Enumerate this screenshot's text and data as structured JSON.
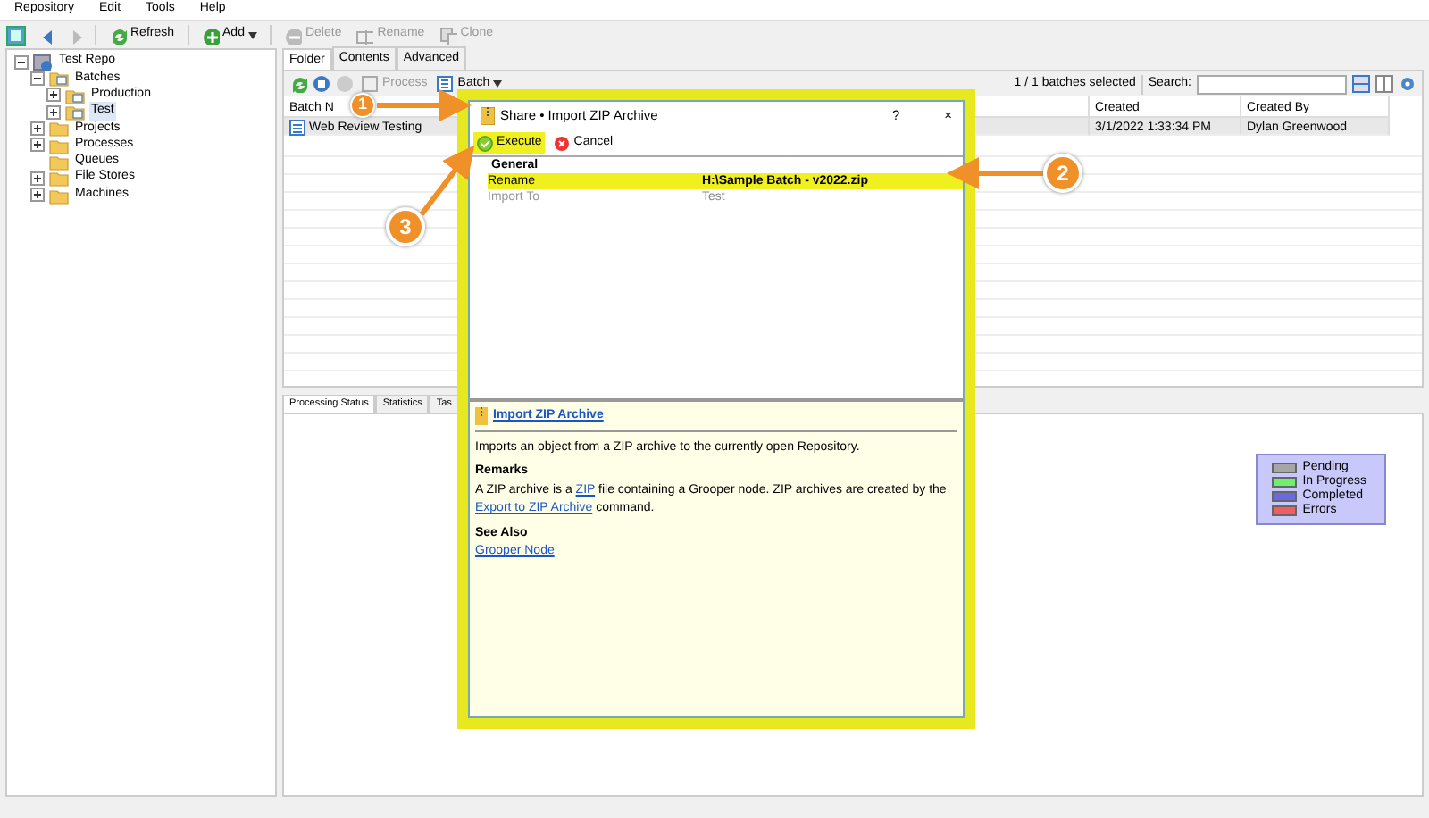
{
  "menu": [
    "Repository",
    "Edit",
    "Tools",
    "Help"
  ],
  "toolbar": [
    {
      "kind": "nav-back",
      "disabled": false
    },
    {
      "kind": "nav-forward",
      "disabled": true
    },
    {
      "kind": "refresh",
      "label": "Refresh",
      "disabled": false
    },
    {
      "kind": "add",
      "label": "Add",
      "disabled": false,
      "dropdown": true
    },
    {
      "kind": "delete",
      "label": "Delete",
      "disabled": true
    },
    {
      "kind": "rename",
      "label": "Rename",
      "disabled": true
    },
    {
      "kind": "clone",
      "label": "Clone",
      "disabled": true
    }
  ],
  "tree": [
    {
      "label": "Test Repo",
      "kind": "repo",
      "expanded": true,
      "selected": false,
      "children": [
        {
          "label": "Batches",
          "kind": "batches",
          "expanded": true,
          "selected": false,
          "children": [
            {
              "label": "Production",
              "kind": "batches",
              "expanded": false,
              "selected": false
            },
            {
              "label": "Test",
              "kind": "batches",
              "expanded": false,
              "selected": true
            }
          ]
        },
        {
          "label": "Projects",
          "kind": "folder",
          "expanded": false,
          "selected": false
        },
        {
          "label": "Processes",
          "kind": "folder",
          "expanded": false,
          "selected": false
        },
        {
          "label": "Queues",
          "kind": "leaf",
          "selected": false
        },
        {
          "label": "File Stores",
          "kind": "folder",
          "expanded": false,
          "selected": false
        },
        {
          "label": "Machines",
          "kind": "folder",
          "expanded": false,
          "selected": false
        }
      ]
    }
  ],
  "tabs": [
    {
      "label": "Folder",
      "selected": true
    },
    {
      "label": "Contents",
      "selected": false
    },
    {
      "label": "Advanced",
      "selected": false
    }
  ],
  "folder_toolbar": {
    "process": {
      "label": "Process",
      "disabled": true
    },
    "batch": {
      "label": "Batch"
    },
    "selection": "1 / 1 batches selected",
    "search_label": "Search:"
  },
  "table": {
    "columns": [
      "Batch N",
      "Created",
      "Created By"
    ],
    "rows": [
      {
        "cells": [
          "Web Review Testing",
          "3/1/2022 1:33:34 PM",
          "Dylan Greenwood"
        ],
        "selected": true
      }
    ]
  },
  "bottom_tabs": [
    {
      "label": "Processing Status",
      "selected": true
    },
    {
      "label": "Statistics",
      "selected": false
    },
    {
      "label": "Tas",
      "selected": false
    }
  ],
  "legend": [
    {
      "label": "Pending",
      "color": "#a6a6a6"
    },
    {
      "label": "In Progress",
      "color": "#6fef6f"
    },
    {
      "label": "Completed",
      "color": "#6a6ade"
    },
    {
      "label": "Errors",
      "color": "#ef5f5f"
    }
  ],
  "dialog": {
    "title": "Share • Import ZIP Archive",
    "help": "?",
    "close": "×",
    "buttons": [
      {
        "kind": "execute",
        "label": "Execute",
        "highlighted": true
      },
      {
        "kind": "cancel",
        "label": "Cancel",
        "highlighted": false
      }
    ],
    "section": "General",
    "properties": [
      {
        "name": "Rename",
        "value": "H:\\Sample Batch - v2022.zip",
        "highlighted": true
      },
      {
        "name": "Import To",
        "value": "Test",
        "highlighted": false
      }
    ],
    "help_panel": {
      "title": "Import ZIP Archive",
      "description": "Imports an object from a ZIP archive to the currently open Repository.",
      "remarks_heading": "Remarks",
      "remarks": [
        {
          "kind": "text",
          "text": "A ZIP archive is a "
        },
        {
          "kind": "link",
          "text": "ZIP"
        },
        {
          "kind": "text",
          "text": " file containing a Grooper node. ZIP archives are created by the "
        },
        {
          "kind": "link",
          "text": "Export to ZIP Archive"
        },
        {
          "kind": "text",
          "text": " command."
        }
      ],
      "see_also_heading": "See Also",
      "see_also": [
        "Grooper Node"
      ]
    }
  },
  "callouts": [
    "1",
    "2",
    "3"
  ]
}
